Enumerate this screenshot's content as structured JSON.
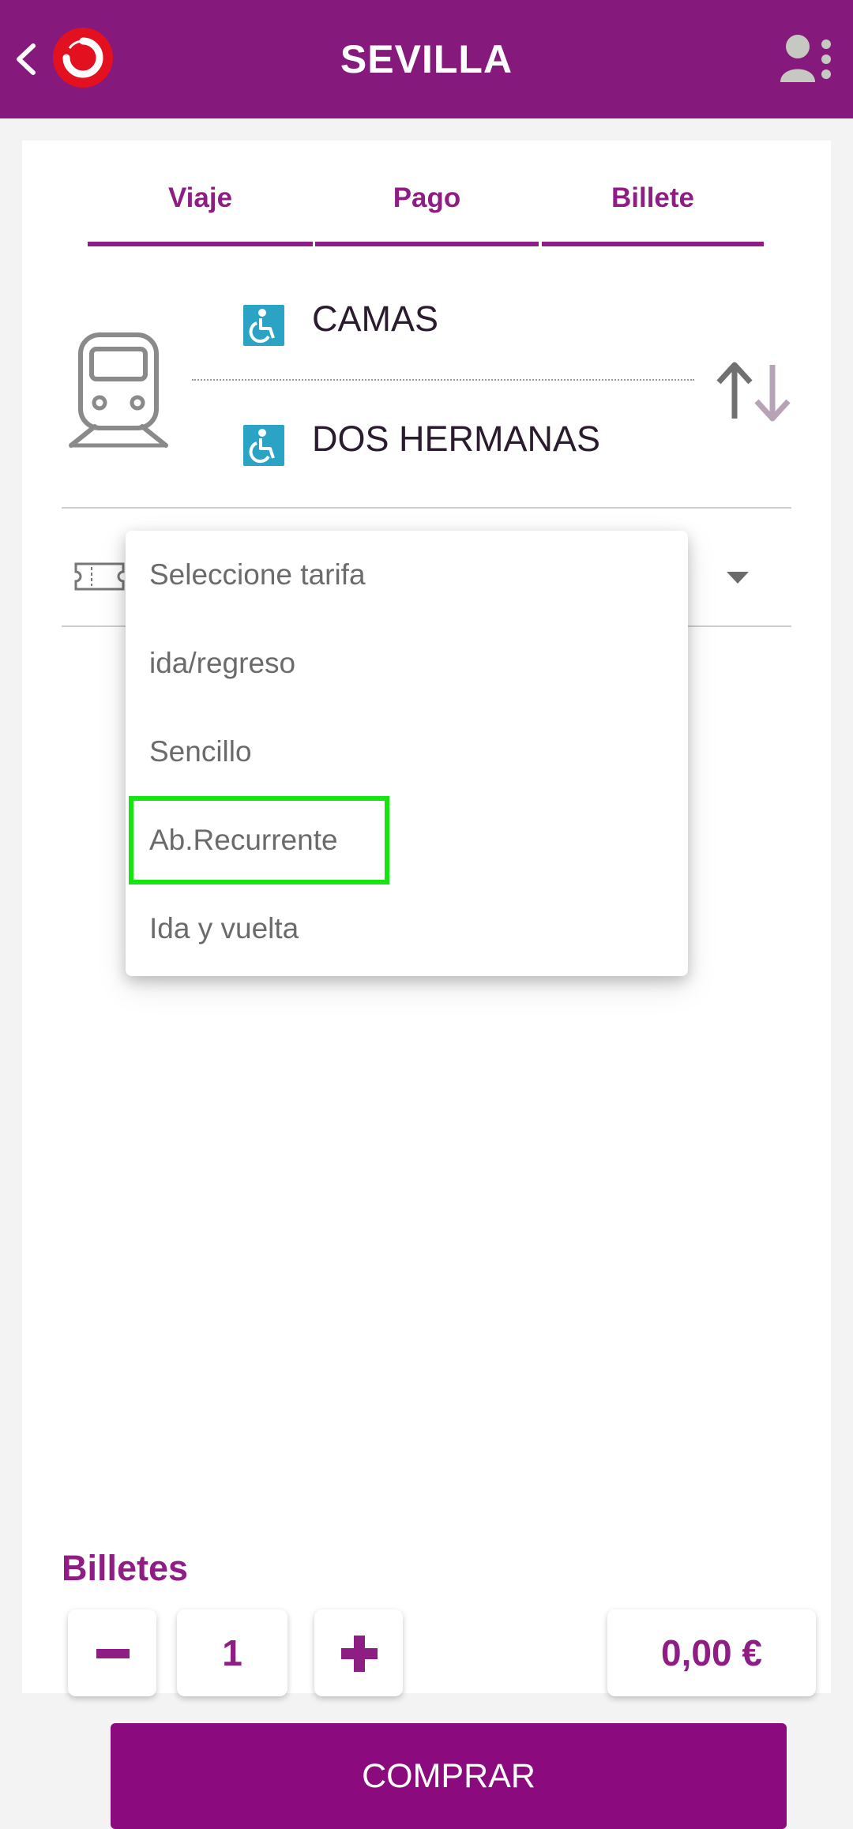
{
  "header": {
    "title": "SEVILLA",
    "back_icon": "chevron-left-icon",
    "user_icon": "user-settings-icon",
    "brand_color": "#85197c"
  },
  "tabs": [
    {
      "label": "Viaje"
    },
    {
      "label": "Pago"
    },
    {
      "label": "Billete"
    }
  ],
  "journey": {
    "origin": "CAMAS",
    "destination": "DOS HERMANAS"
  },
  "fare_dropdown": {
    "options": [
      "Seleccione tarifa",
      "ida/regreso",
      "Sencillo",
      "Ab.Recurrente",
      "Ida y vuelta"
    ]
  },
  "tickets": {
    "label": "Billetes",
    "quantity": "1",
    "price": "0,00 €"
  },
  "buy_button": {
    "label": "COMPRAR"
  }
}
